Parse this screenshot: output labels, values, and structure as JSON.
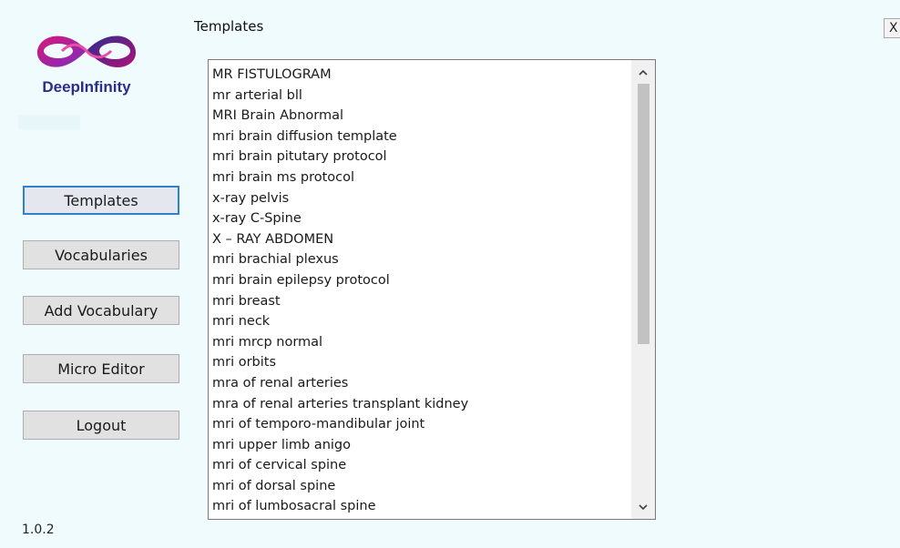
{
  "logo": {
    "text": "DeepInfinity",
    "colors": {
      "magenta": "#d6197a",
      "violet": "#7b2cbf",
      "blue": "#2a2d8c",
      "pink": "#e94da6"
    }
  },
  "sidebar": {
    "buttons": [
      {
        "label": "Templates",
        "active": true
      },
      {
        "label": "Vocabularies",
        "active": false
      },
      {
        "label": "Add Vocabulary",
        "active": false
      },
      {
        "label": "Micro Editor",
        "active": false
      },
      {
        "label": "Logout",
        "active": false
      }
    ],
    "version": "1.0.2"
  },
  "main": {
    "title": "Templates",
    "close_label": "X",
    "templates": [
      "MR FISTULOGRAM",
      "mr arterial bll",
      "MRI Brain Abnormal",
      "mri brain diffusion template",
      "mri brain pitutary protocol",
      "mri brain ms protocol",
      " x-ray pelvis",
      "x-ray C-Spine",
      "X – RAY ABDOMEN",
      "mri brachial plexus",
      "mri brain epilepsy protocol",
      "mri breast",
      "mri neck",
      "mri mrcp normal",
      "mri orbits",
      "mra of renal arteries",
      "mra of renal arteries transplant kidney",
      "mri of temporo-mandibular joint",
      "mri upper limb anigo",
      "mri of cervical spine",
      "mri of dorsal spine",
      "mri of lumbosacral spine"
    ],
    "scroll_icons": {
      "up": "chevron-up-icon",
      "down": "chevron-down-icon"
    }
  },
  "colors": {
    "background": "#f0fbfd",
    "active_border": "#2f7fd4",
    "button_bg": "#e1e1e1"
  }
}
